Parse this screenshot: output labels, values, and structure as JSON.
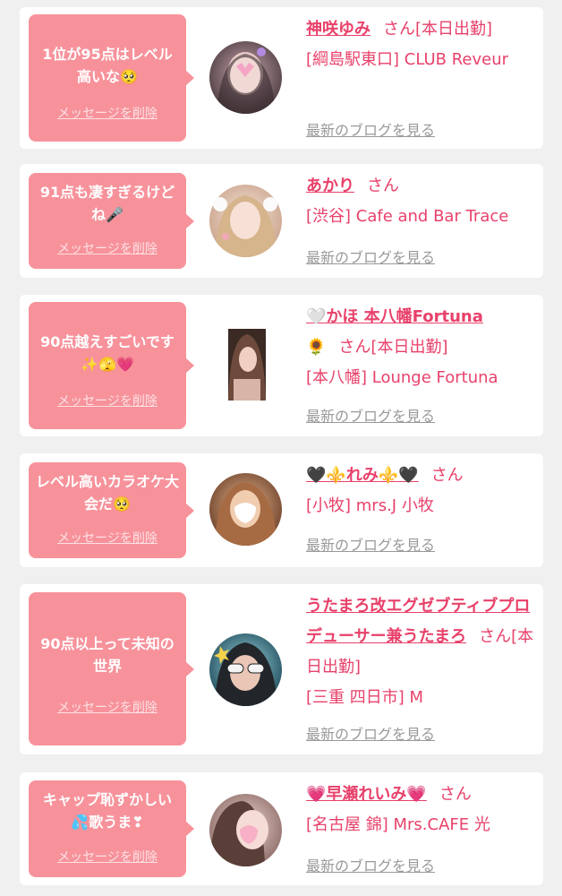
{
  "colors": {
    "accent": "#e8416a",
    "bubble": "#f7929b",
    "background": "#f0f0f0",
    "card": "#ffffff",
    "blog_link": "#999999"
  },
  "entries": [
    {
      "message": "1位が95点はレベル高いな🥺",
      "delete_label": "メッセージを削除",
      "name": "神咲ゆみ",
      "honorific": "さん",
      "status": "[本日出勤]",
      "shop": "[綱島駅東口] CLUB Reveur",
      "blog_label": "最新のブログを見る"
    },
    {
      "message": "91点も凄すぎるけどね🎤",
      "delete_label": "メッセージを削除",
      "name": "あかり",
      "honorific": "さん",
      "status": "",
      "shop": "[渋谷] Cafe and Bar Trace",
      "blog_label": "最新のブログを見る"
    },
    {
      "message": "90点越えすごいです✨🫣💗",
      "delete_label": "メッセージを削除",
      "name": "🤍かほ 本八幡Fortuna",
      "name_suffix": "🌻",
      "honorific": "さん",
      "status": "[本日出勤]",
      "shop": "[本八幡] Lounge Fortuna",
      "blog_label": "最新のブログを見る"
    },
    {
      "message": "レベル高いカラオケ大会だ🥺",
      "delete_label": "メッセージを削除",
      "name": "🖤⚜️れみ⚜️🖤",
      "honorific": "さん",
      "status": "",
      "shop": "[小牧] mrs.J 小牧",
      "blog_label": "最新のブログを見る"
    },
    {
      "message": "90点以上って未知の世界",
      "delete_label": "メッセージを削除",
      "name": "うたまろ改エグゼブティブプロデューサー兼うたまろ",
      "honorific": "さん",
      "status": "[本日出勤]",
      "shop": "[三重 四日市] M",
      "blog_label": "最新のブログを見る"
    },
    {
      "message": "キャップ恥ずかしい💦歌うま❣",
      "delete_label": "メッセージを削除",
      "name": "💗早瀬れいみ💗",
      "honorific": "さん",
      "status": "",
      "shop": "[名古屋 錦] Mrs.CAFE 光",
      "blog_label": "最新のブログを見る"
    }
  ]
}
